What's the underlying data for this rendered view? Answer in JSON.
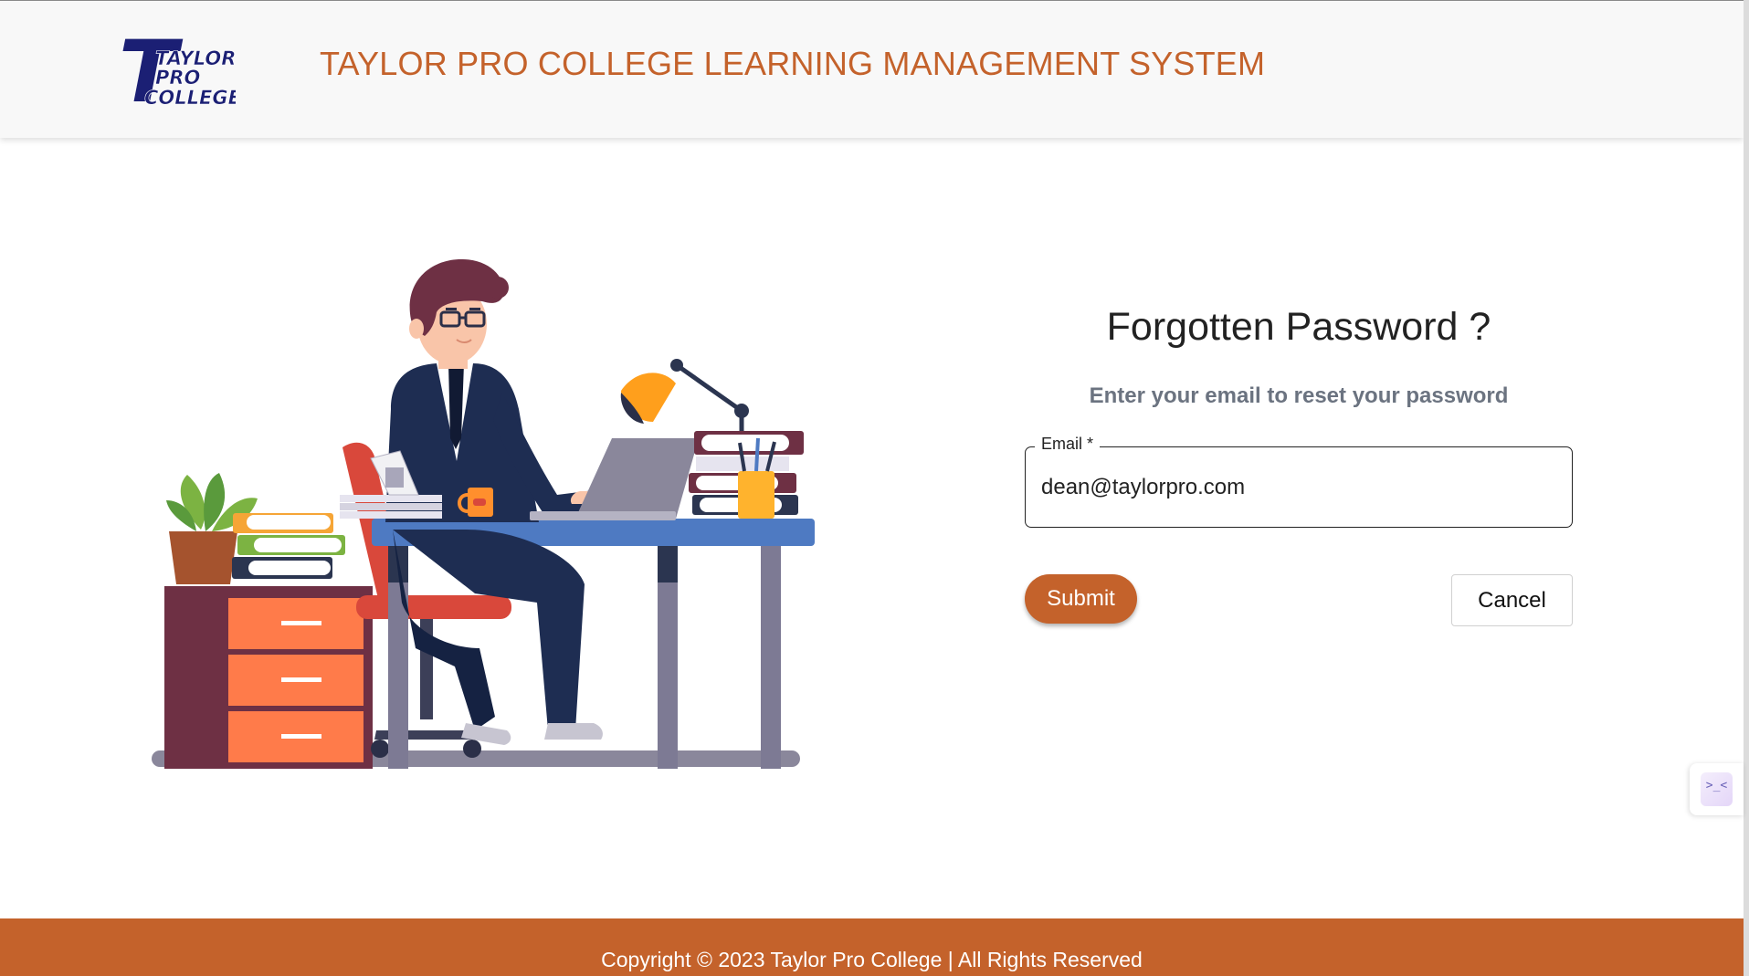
{
  "header": {
    "logo": {
      "lines": [
        "TAYLOR",
        "PRO",
        "COLLEGE"
      ],
      "big_letter": "T"
    },
    "title": "TAYLOR PRO COLLEGE LEARNING MANAGEMENT SYSTEM"
  },
  "form": {
    "title": "Forgotten Password ?",
    "subtitle": "Enter your email to reset your password",
    "email_label": "Email *",
    "email_value": "dean@taylorpro.com",
    "submit_label": "Submit",
    "cancel_label": "Cancel"
  },
  "widget": {
    "icon": "terminal-icon",
    "glyph": ">_<"
  },
  "footer": {
    "copyright": "Copyright © 2023 Taylor Pro College | All Rights Reserved"
  },
  "colors": {
    "brand": "#c4622b",
    "logo_navy": "#1b1f74",
    "header_bg": "#f8f8f8",
    "illustration_navy": "#1e2d52",
    "desk_blue": "#4e7ac2",
    "cabinet_purple": "#6e3044",
    "drawer_orange": "#ff7b4a"
  },
  "illustration": {
    "subject": "person-working-at-desk-illustration"
  }
}
